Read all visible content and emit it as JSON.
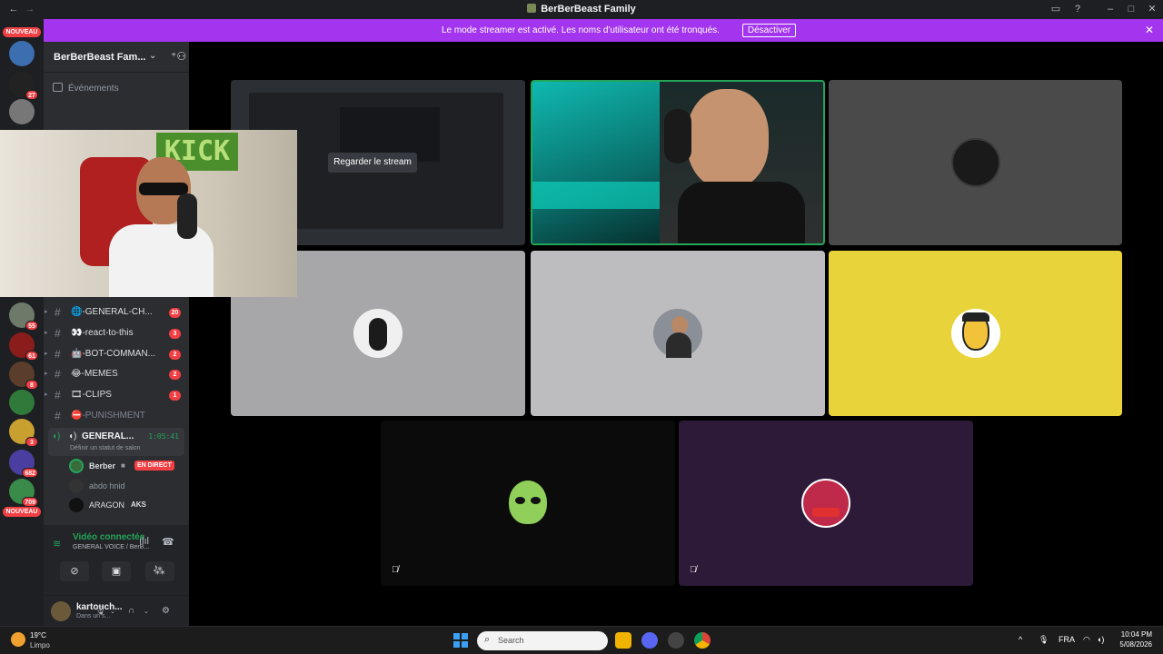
{
  "window": {
    "title": "BerBerBeast Family",
    "icons": [
      "back-arrow-icon",
      "forward-arrow-icon",
      "inbox-icon",
      "help-icon",
      "minimize-icon",
      "maximize-icon",
      "close-icon"
    ]
  },
  "banner": {
    "message": "Le mode streamer est activé. Les noms d'utilisateur ont été tronqués.",
    "button_label": "Désactiver",
    "color": "#a335ee"
  },
  "server_rail": {
    "nouveau_top": "NOUVEAU",
    "nouveau_bottom": "NOUVEAU",
    "badges": [
      "27",
      "55",
      "61",
      "8",
      "3",
      "682",
      "709"
    ]
  },
  "guild": {
    "name": "BerBerBeast Fam...",
    "events_label": "Événements"
  },
  "channels": [
    {
      "label": "🌐-GENERAL-CH...",
      "count": "20"
    },
    {
      "label": "👀-react-to-this",
      "count": "3"
    },
    {
      "label": "🤖-BOT-COMMAN...",
      "count": "2"
    },
    {
      "label": "😂-MEMES",
      "count": "2"
    },
    {
      "label": "🎞-CLIPS",
      "count": "1"
    },
    {
      "label": "⛔-PUNISHMENT",
      "count": ""
    }
  ],
  "voice_channel": {
    "label": "GENERAL...",
    "time": "1:05:41",
    "status_hint": "Définir un statut de salon",
    "users": [
      {
        "name": "Berber",
        "live_label": "EN DIRECT"
      },
      {
        "name": "abdo hnid"
      },
      {
        "name": "ARAGON",
        "tag": "AKS"
      }
    ]
  },
  "voice_panel": {
    "status": "Vidéo connectée",
    "path": "GENERAL VOICE / BerB..."
  },
  "user_panel": {
    "username": "kartouch...",
    "status": "Dans un s..."
  },
  "stage": {
    "stream_button": "Regarder le stream",
    "tiles": [
      {
        "kind": "stream",
        "bg": "#2c2f33"
      },
      {
        "kind": "webcam",
        "border": "#23a55a"
      },
      {
        "kind": "avatar",
        "bg": "#4a4a4a"
      },
      {
        "kind": "avatar",
        "bg": "#a7a7a9"
      },
      {
        "kind": "avatar",
        "bg": "#bdbdbf"
      },
      {
        "kind": "avatar",
        "bg": "#e8d33a"
      },
      {
        "kind": "avatar",
        "bg": "#0b0b0b",
        "muted": true
      },
      {
        "kind": "avatar",
        "bg": "#2c1a38",
        "muted": true
      }
    ]
  },
  "taskbar": {
    "temperature": "19°C",
    "condition": "Limpo",
    "search_placeholder": "Search",
    "language": "FRA",
    "time": "10:04 PM",
    "date": "5/08/2026"
  }
}
